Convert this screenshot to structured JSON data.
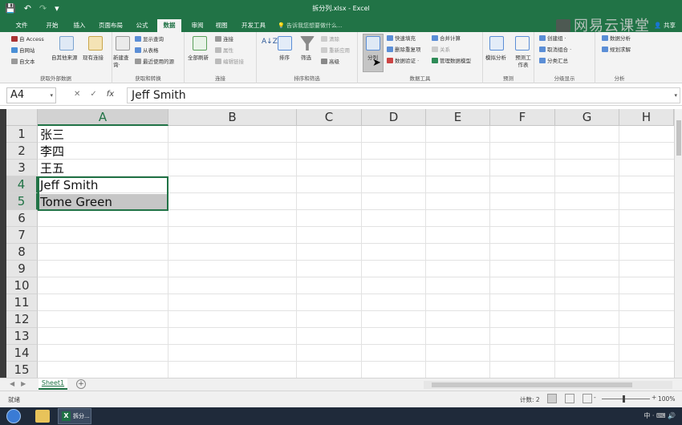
{
  "window": {
    "title": "拆分列.xlsx - Excel",
    "tell_me": "告诉我您想要做什么...",
    "share": "共享",
    "watermark": "网易云课堂"
  },
  "qat": {
    "save": "💾",
    "undo": "↶",
    "redo": "↷",
    "more": "▾"
  },
  "tabs": [
    {
      "label": "文件"
    },
    {
      "label": "开始"
    },
    {
      "label": "插入"
    },
    {
      "label": "页面布局"
    },
    {
      "label": "公式"
    },
    {
      "label": "数据"
    },
    {
      "label": "审阅"
    },
    {
      "label": "视图"
    },
    {
      "label": "开发工具"
    }
  ],
  "ribbon": {
    "get_external": {
      "label": "获取外部数据",
      "access": "自 Access",
      "web": "自网站",
      "text": "自文本",
      "other": "自其他来源",
      "existing": "现有连接"
    },
    "get_transform": {
      "label": "获取和转换",
      "new_query": "新建查询·",
      "show_queries": "显示查询",
      "from_table": "从表格",
      "recent": "最近使用的源"
    },
    "connections": {
      "label": "连接",
      "refresh_all": "全部刷新",
      "conn": "连接",
      "props": "属性",
      "edit_links": "编辑链接"
    },
    "sort_filter": {
      "label": "排序和筛选",
      "sort": "排序",
      "filter": "筛选",
      "clear": "清除",
      "reapply": "重新应用",
      "advanced": "高级"
    },
    "data_tools": {
      "label": "数据工具",
      "split": "分列",
      "flash_fill": "快速填充",
      "remove_dup": "删除重复项",
      "validation": "数据验证 ·",
      "consolidate": "合并计算",
      "relationships": "关系",
      "manage_model": "管理数据模型"
    },
    "forecast": {
      "label": "预测",
      "what_if": "模拟分析",
      "forecast_sheet": "预测工作表"
    },
    "outline": {
      "label": "分级显示",
      "group": "创建组 ·",
      "ungroup": "取消组合 ·",
      "subtotal": "分类汇总"
    },
    "analysis": {
      "label": "分析",
      "data_analysis": "数据分析",
      "solver": "规划求解"
    }
  },
  "formula_bar": {
    "name_box": "A4",
    "cancel": "✕",
    "enter": "✓",
    "fx": "fx",
    "content": "Jeff Smith"
  },
  "columns": [
    "A",
    "B",
    "C",
    "D",
    "E",
    "F",
    "G",
    "H"
  ],
  "rows": [
    "1",
    "2",
    "3",
    "4",
    "5",
    "6",
    "7",
    "8",
    "9",
    "10",
    "11",
    "12",
    "13",
    "14",
    "15"
  ],
  "cells": [
    "张三",
    "李四",
    "王五",
    "Jeff Smith",
    "Tome Green"
  ],
  "sheet": {
    "name": "Sheet1",
    "add": "+"
  },
  "status": {
    "ready": "就绪",
    "count": "计数: 2",
    "zoom": "100%",
    "minus": "-",
    "plus": "+"
  },
  "taskbar": {
    "app_label": "拆分...",
    "tray": "中 · ⌨ 🔊"
  }
}
